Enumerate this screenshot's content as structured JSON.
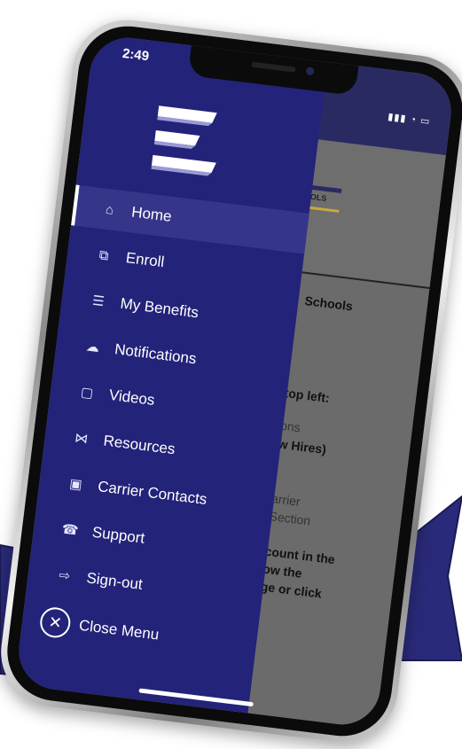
{
  "status_bar": {
    "time": "2:49",
    "icons": "▮▮▮ ◔ ▭"
  },
  "drawer": {
    "logo_icon": "three-stripe-logo",
    "items": [
      {
        "label": "Home",
        "icon": "home-icon",
        "glyph": "⌂",
        "active": true
      },
      {
        "label": "Enroll",
        "icon": "enroll-icon",
        "glyph": "⧉",
        "active": false
      },
      {
        "label": "My Benefits",
        "icon": "benefits-list-icon",
        "glyph": "☰",
        "active": false
      },
      {
        "label": "Notifications",
        "icon": "notification-icon",
        "glyph": "☁",
        "active": false
      },
      {
        "label": "Videos",
        "icon": "video-icon",
        "glyph": "▢",
        "active": false
      },
      {
        "label": "Resources",
        "icon": "resources-icon",
        "glyph": "⋈",
        "active": false
      },
      {
        "label": "Carrier Contacts",
        "icon": "carrier-contacts-icon",
        "glyph": "▣",
        "active": false
      },
      {
        "label": "Support",
        "icon": "support-icon",
        "glyph": "☎",
        "active": false
      },
      {
        "label": "Sign-out",
        "icon": "sign-out-icon",
        "glyph": "⇨",
        "active": false
      }
    ],
    "close_label": "Close Menu",
    "close_glyph": "✕"
  },
  "background_page": {
    "logo_text": "SCHOOLS",
    "lines": [
      {
        "text": "Schools",
        "bold": true
      },
      {
        "text": "top left:",
        "bold": true
      },
      {
        "text": "ons",
        "bold": false
      },
      {
        "text": "w Hires)",
        "bold": true
      },
      {
        "text": "arrier",
        "bold": false
      },
      {
        "text": "Section",
        "bold": false
      },
      {
        "text": "count in the",
        "bold": true
      },
      {
        "text": "ow the",
        "bold": true
      },
      {
        "text": "ge or click",
        "bold": true
      }
    ]
  },
  "colors": {
    "drawer": "#23237a",
    "ribbon": "#2a2a7a",
    "accent_gold": "#c9a93a"
  }
}
